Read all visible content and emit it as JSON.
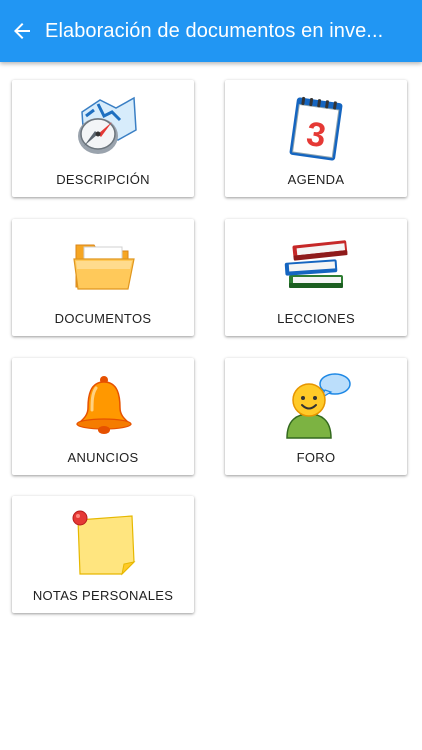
{
  "header": {
    "title": "Elaboración de documentos en inve...",
    "back_icon": "arrow-left-icon"
  },
  "colors": {
    "appbar": "#2196f3",
    "card_background": "#ffffff"
  },
  "menu": {
    "items": [
      {
        "label": "DESCRIPCIÓN",
        "icon": "compass-map-icon"
      },
      {
        "label": "AGENDA",
        "icon": "calendar-icon"
      },
      {
        "label": "DOCUMENTOS",
        "icon": "folder-icon"
      },
      {
        "label": "LECCIONES",
        "icon": "books-icon"
      },
      {
        "label": "ANUNCIOS",
        "icon": "bell-icon"
      },
      {
        "label": "FORO",
        "icon": "user-speech-icon"
      },
      {
        "label": "NOTAS PERSONALES",
        "icon": "sticky-note-icon"
      }
    ],
    "calendar_day": "3"
  }
}
